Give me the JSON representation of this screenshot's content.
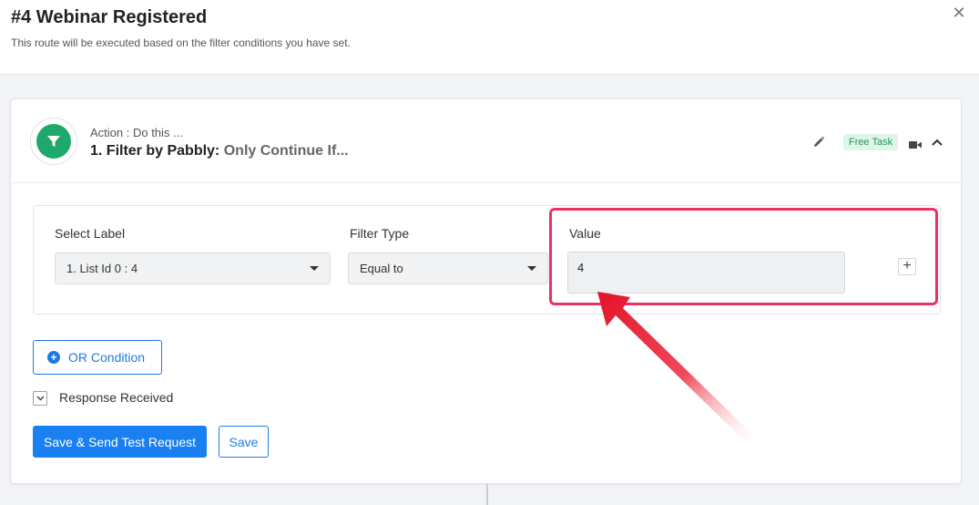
{
  "header": {
    "title": "#4 Webinar Registered",
    "subtitle": "This route will be executed based on the filter conditions you have set.",
    "close_icon": "close-icon"
  },
  "action": {
    "kicker": "Action : Do this ...",
    "name": "1. Filter by Pabbly:",
    "name_sub": "Only Continue If...",
    "badge": "Free Task",
    "icon": "filter-icon",
    "icon_color": "#1fa86b"
  },
  "filter": {
    "select_label": {
      "label": "Select Label",
      "value": "1. List Id 0 : 4"
    },
    "filter_type": {
      "label": "Filter Type",
      "value": "Equal to"
    },
    "value": {
      "label": "Value",
      "value": "4"
    }
  },
  "buttons": {
    "or_condition": "OR Condition",
    "save_test": "Save & Send Test Request",
    "save": "Save"
  },
  "response": {
    "label": "Response Received"
  },
  "colors": {
    "primary": "#1a7ff0",
    "highlight": "#ee2f62",
    "badge_bg": "#dff5ea",
    "badge_text": "#1b9a5c"
  }
}
